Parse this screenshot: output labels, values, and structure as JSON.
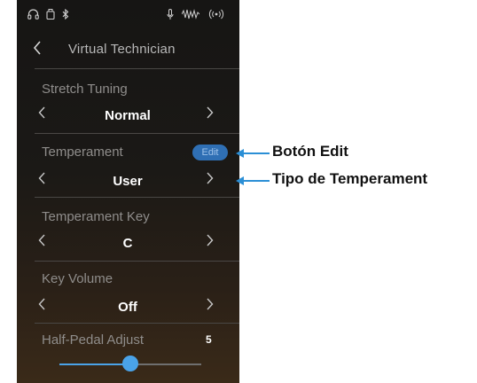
{
  "status_bar": {
    "icons": [
      "headphones-icon",
      "usb-icon",
      "bluetooth-icon",
      "microphone-icon",
      "waveform-icon",
      "wireless-icon"
    ]
  },
  "header": {
    "back_icon": "chevron-left-icon",
    "title": "Virtual Technician"
  },
  "settings": [
    {
      "label": "Stretch Tuning",
      "value": "Normal"
    },
    {
      "label": "Temperament",
      "value": "User",
      "edit_label": "Edit"
    },
    {
      "label": "Temperament Key",
      "value": "C"
    },
    {
      "label": "Key Volume",
      "value": "Off"
    },
    {
      "label": "Half-Pedal Adjust",
      "value": "5",
      "slider_level": 0.5
    }
  ],
  "callouts": [
    {
      "label": "Botón Edit"
    },
    {
      "label": "Tipo de Temperament"
    }
  ],
  "colors": {
    "accent": "#4aa3e8",
    "edit_button": "#2f6fb4",
    "callout": "#2b8fd6"
  }
}
